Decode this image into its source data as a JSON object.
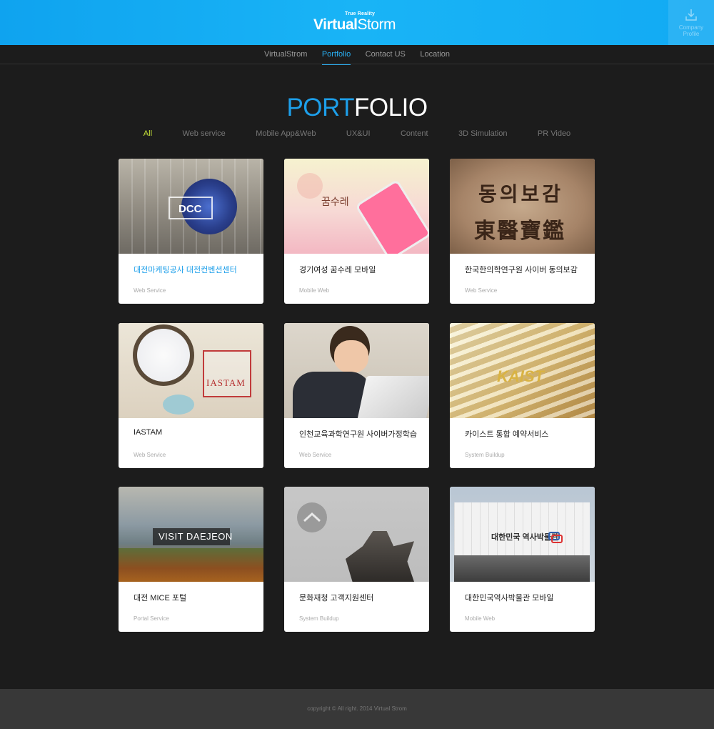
{
  "header": {
    "logo_tagline": "True Reality",
    "logo_bold": "Virtual",
    "logo_light": "Storm",
    "profile_line1": "Company",
    "profile_line2": "Profile",
    "profile_icon": "download-icon"
  },
  "nav": {
    "items": [
      {
        "label": "VirtualStrom",
        "active": false
      },
      {
        "label": "Portfolio",
        "active": true
      },
      {
        "label": "Contact US",
        "active": false
      },
      {
        "label": "Location",
        "active": false
      }
    ]
  },
  "title": {
    "accent": "PORT",
    "rest": "FOLIO"
  },
  "filters": [
    {
      "label": "All",
      "active": true
    },
    {
      "label": "Web service"
    },
    {
      "label": "Mobile App&Web"
    },
    {
      "label": "UX&UI"
    },
    {
      "label": "Content"
    },
    {
      "label": "3D Simulation"
    },
    {
      "label": "PR Video"
    }
  ],
  "cards": [
    {
      "title": "대전마케팅공사 대전컨벤션센터",
      "category": "Web Service",
      "thumb_text": "DCC"
    },
    {
      "title": "경기여성 꿈수레 모바일",
      "category": "Mobile Web",
      "thumb_text": "꿈수레"
    },
    {
      "title": "한국한의학연구원 사이버 동의보감",
      "category": "Web Service",
      "thumb_text": "동의보감",
      "thumb_text2": "東醫寶鑑"
    },
    {
      "title": "IASTAM",
      "category": "Web Service",
      "thumb_text": "IASTAM"
    },
    {
      "title": "인천교육과학연구원 사이버가정학습",
      "category": "Web Service"
    },
    {
      "title": "카이스트 통합 예약서비스",
      "category": "System Buildup",
      "thumb_text": "KAIST"
    },
    {
      "title": "대전 MICE 포털",
      "category": "Portal Service",
      "thumb_text": "VISIT DAEJEON"
    },
    {
      "title": "문화재청 고객지원센터",
      "category": "System Buildup"
    },
    {
      "title": "대한민국역사박물관 모바일",
      "category": "Mobile Web",
      "thumb_text": "대한민국 역사박물관"
    }
  ],
  "footer": {
    "text": "copyright © All right. 2014 Virtual Strom"
  }
}
